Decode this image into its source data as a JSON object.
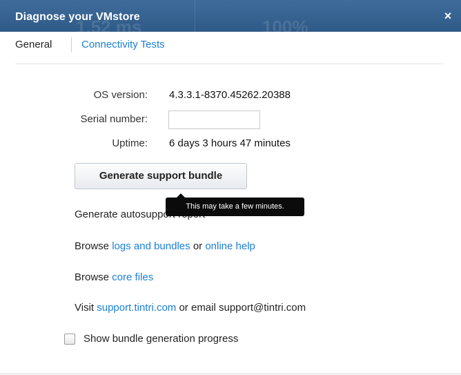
{
  "dialog": {
    "title": "Diagnose your VMstore",
    "close_glyph": "×",
    "background_ghost": {
      "left": "1.52 ms",
      "right": "100%"
    }
  },
  "tabs": [
    {
      "label": "General",
      "active": true
    },
    {
      "label": "Connectivity Tests",
      "active": false
    }
  ],
  "info": {
    "os_version_label": "OS version:",
    "os_version_value": "4.3.3.1-8370.45262.20388",
    "serial_label": "Serial number:",
    "serial_value": "",
    "uptime_label": "Uptime:",
    "uptime_value": "6 days 3 hours 47 minutes"
  },
  "actions": {
    "generate_bundle_label": "Generate support bundle",
    "tooltip": "This may take a few minutes.",
    "autosupport_link": "Generate autosupport report"
  },
  "browse_logs": {
    "prefix": "Browse",
    "logs_link": "logs and bundles",
    "middle": "or",
    "help_link": "online help"
  },
  "browse_core": {
    "prefix": "Browse",
    "core_link": "core files"
  },
  "visit": {
    "prefix": "Visit",
    "support_link": "support.tintri.com",
    "suffix": "or email support@tintri.com"
  },
  "progress_checkbox": {
    "label": "Show bundle generation progress",
    "checked": false
  },
  "colors": {
    "titlebar": "#3a6896",
    "link": "#1a7fd6",
    "tooltip_bg": "#0b0b0b"
  }
}
